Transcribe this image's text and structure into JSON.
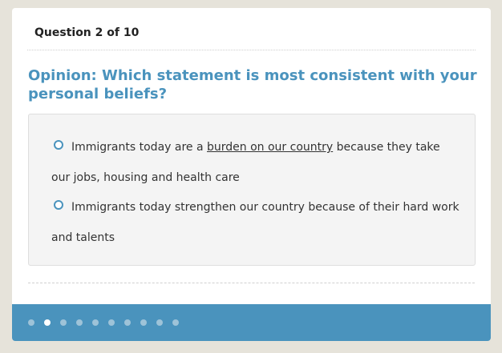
{
  "header": {
    "question_counter": "Question 2 of 10"
  },
  "question": {
    "prompt": "Opinion: Which statement is most consistent with your personal beliefs?",
    "options": [
      {
        "text_before": "Immigrants today are a ",
        "link_text": "burden on our country",
        "text_after": " because they take our jobs, housing and health care"
      },
      {
        "text": "Immigrants today strengthen our country because of their hard work and talents"
      }
    ]
  },
  "progress": {
    "total": 10,
    "current": 2
  },
  "colors": {
    "accent": "#4a93bd",
    "background": "#e6e3da"
  }
}
